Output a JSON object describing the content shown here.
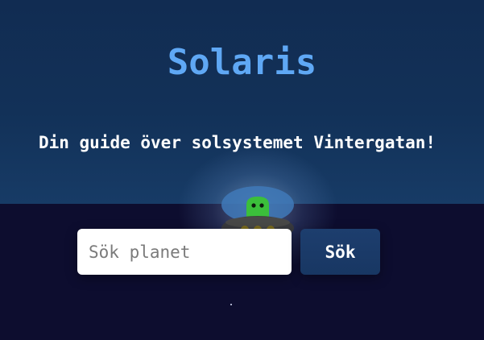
{
  "header": {
    "title": "Solaris",
    "subtitle": "Din guide över solsystemet Vintergatan!"
  },
  "search": {
    "placeholder": "Sök planet",
    "value": "",
    "button_label": "Sök"
  },
  "colors": {
    "title": "#5fa8f5",
    "header_bg": "#123158",
    "page_bg": "#0d0d2f",
    "button_bg": "#1d3e6e"
  },
  "icons": {
    "mascot": "ufo-alien-icon",
    "star": "star-dot-icon"
  }
}
